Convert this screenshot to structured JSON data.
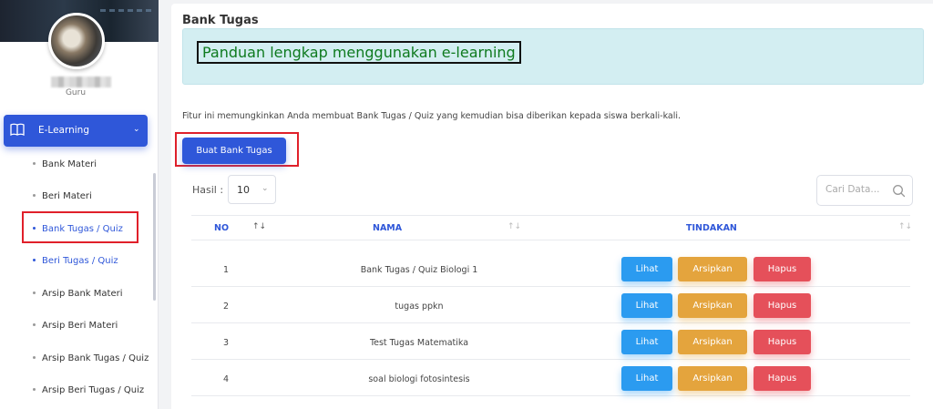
{
  "sidebar": {
    "user_role": "Guru",
    "menu": {
      "label": "E-Learning",
      "icon": "book-icon",
      "chevron": "⌄"
    },
    "items": [
      {
        "label": "Bank Materi",
        "active": false
      },
      {
        "label": "Beri Materi",
        "active": false
      },
      {
        "label": "Bank Tugas / Quiz",
        "active": true
      },
      {
        "label": "Beri Tugas / Quiz",
        "active": true
      },
      {
        "label": "Arsip Bank Materi",
        "active": false
      },
      {
        "label": "Arsip Beri Materi",
        "active": false
      },
      {
        "label": "Arsip Bank Tugas / Quiz",
        "active": false
      },
      {
        "label": "Arsip Beri Tugas / Quiz",
        "active": false
      }
    ]
  },
  "main": {
    "title": "Bank Tugas",
    "guide_link": "Panduan lengkap menggunakan e-learning",
    "description": "Fitur ini memungkinkan Anda membuat Bank Tugas / Quiz yang kemudian bisa diberikan kepada siswa berkali-kali.",
    "create_button": "Buat Bank Tugas",
    "page_size": {
      "label": "Hasil :",
      "value": "10"
    },
    "search": {
      "placeholder": "Cari Data..."
    },
    "table": {
      "columns": [
        "NO",
        "NAMA",
        "TINDAKAN"
      ],
      "rows": [
        {
          "no": "1",
          "nama": "Bank Tugas / Quiz Biologi 1"
        },
        {
          "no": "2",
          "nama": "tugas ppkn"
        },
        {
          "no": "3",
          "nama": "Test Tugas Matematika"
        },
        {
          "no": "4",
          "nama": "soal biologi fotosintesis"
        }
      ],
      "actions": {
        "view": "Lihat",
        "archive": "Arsipkan",
        "delete": "Hapus"
      }
    }
  },
  "colors": {
    "primary": "#2f57d9",
    "view": "#2b9bf0",
    "archive": "#e4a43d",
    "delete": "#e5505a",
    "highlight_border": "#e0202a"
  }
}
